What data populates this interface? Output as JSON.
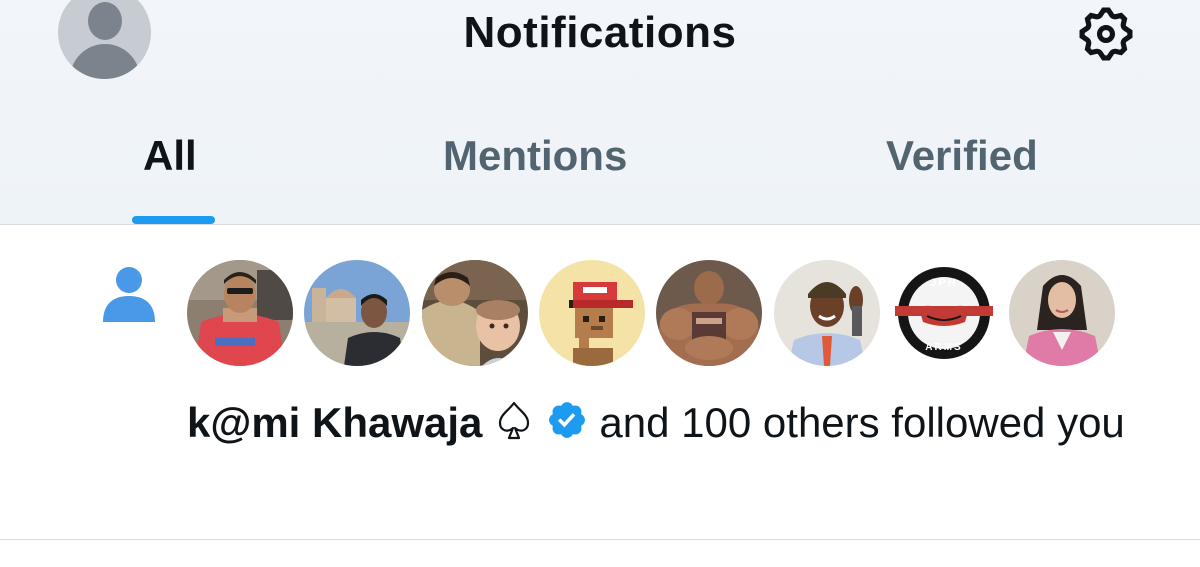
{
  "header": {
    "title": "Notifications",
    "icons": {
      "profile": "default-avatar-icon",
      "settings": "gear-icon"
    }
  },
  "tabs": [
    {
      "label": "All",
      "active": true
    },
    {
      "label": "Mentions",
      "active": false
    },
    {
      "label": "Verified",
      "active": false
    }
  ],
  "notification": {
    "type_icon": "person-icon",
    "avatars": [
      "avatar-man-red-jersey",
      "avatar-man-atlantis-hotel",
      "avatar-man-with-baby",
      "avatar-pixel-maga-cap",
      "avatar-bodybuilder",
      "avatar-man-hat-salute",
      "avatar-jph-arms-logo",
      "avatar-woman-pink-blazer"
    ],
    "name": "k@mi Khawaja",
    "name_badges": [
      "spade-icon",
      "verified-badge-icon"
    ],
    "text_rest": "and 100 others followed you"
  },
  "colors": {
    "accent": "#1d9bf0",
    "text_primary": "#0f1419",
    "text_secondary": "#536471",
    "header_bg": "#f2f5f9"
  }
}
